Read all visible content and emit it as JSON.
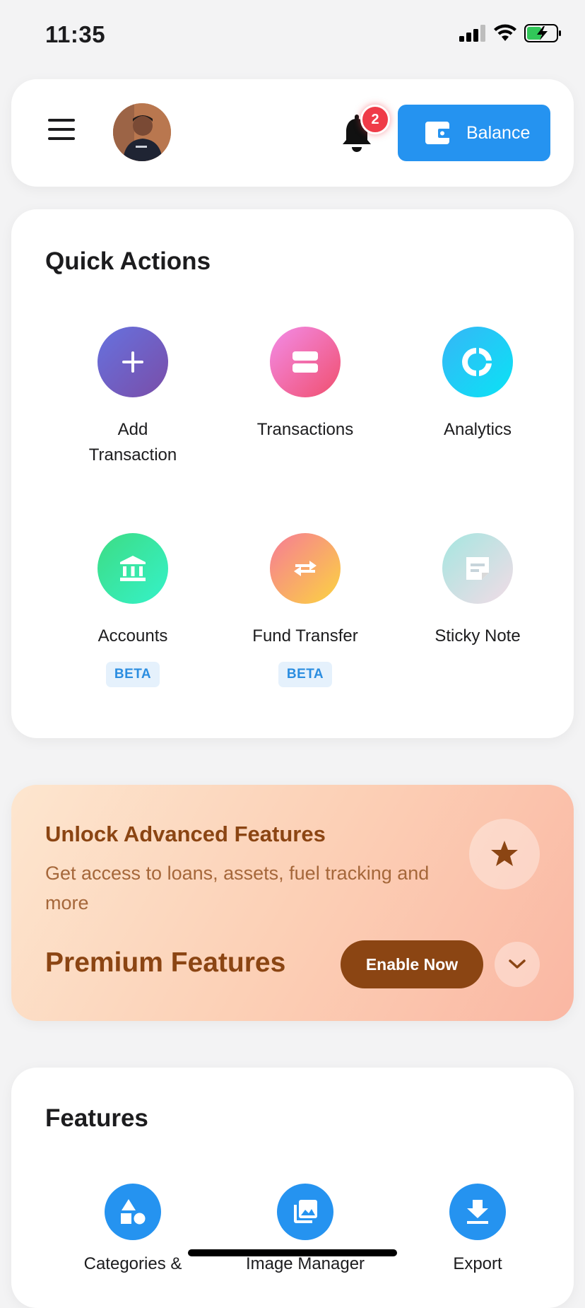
{
  "status_bar": {
    "time": "11:35"
  },
  "header": {
    "notification_count": "2",
    "balance_label": "Balance"
  },
  "quick_actions": {
    "title": "Quick Actions",
    "items": [
      {
        "label": "Add Transaction",
        "icon": "plus-icon"
      },
      {
        "label": "Transactions",
        "icon": "list-icon"
      },
      {
        "label": "Analytics",
        "icon": "donut-chart-icon"
      },
      {
        "label": "Accounts",
        "icon": "bank-icon",
        "badge": "BETA"
      },
      {
        "label": "Fund Transfer",
        "icon": "swap-arrows-icon",
        "badge": "BETA"
      },
      {
        "label": "Sticky Note",
        "icon": "sticky-note-icon"
      }
    ]
  },
  "premium": {
    "title": "Unlock Advanced Features",
    "description": "Get access to loans, assets, fuel tracking and more",
    "name": "Premium Features",
    "cta": "Enable Now"
  },
  "features": {
    "title": "Features",
    "items": [
      {
        "label": "Categories &",
        "icon": "shapes-icon"
      },
      {
        "label": "Image Manager",
        "icon": "image-gallery-icon"
      },
      {
        "label": "Export",
        "icon": "download-icon"
      }
    ]
  },
  "colors": {
    "accent": "#2593f0",
    "premium_brown": "#8b4513",
    "badge_red": "#ef3b48"
  }
}
